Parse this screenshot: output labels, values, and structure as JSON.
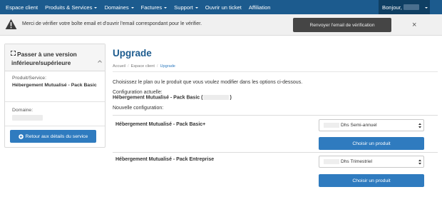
{
  "nav": {
    "items": [
      {
        "label": "Espace client",
        "dropdown": false
      },
      {
        "label": "Produits & Services",
        "dropdown": true
      },
      {
        "label": "Domaines",
        "dropdown": true
      },
      {
        "label": "Factures",
        "dropdown": true
      },
      {
        "label": "Support",
        "dropdown": true
      },
      {
        "label": "Ouvrir un ticket",
        "dropdown": false
      },
      {
        "label": "Affiliation",
        "dropdown": false
      }
    ],
    "greeting": "Bonjour,"
  },
  "alert": {
    "icon": "warning-icon",
    "message": "Merci de vérifier votre boîte email et d'ouvrir l'email correspondant pour le vérifier.",
    "resend_label": "Renvoyer l'email de vérification",
    "close_label": "×"
  },
  "sidebar": {
    "title": "Passer à une version inférieure/supérieure",
    "title_icon": "expand-icon",
    "collapse_icon": "chevron-up-icon",
    "product_label": "Produit/Service:",
    "product_value": "Hébergement Mutualisé - Pack Basic",
    "domain_label": "Domaine:",
    "back_label": "Retour aux détails du service",
    "back_icon": "arrow-circle-left-icon"
  },
  "main": {
    "title": "Upgrade",
    "breadcrumb": [
      "Accueil",
      "Espace client",
      "Upgrade"
    ],
    "intro": "Choisissez le plan ou le produit que vous voulez modifier dans les options ci-dessous.",
    "current_label": "Configuration actuelle:",
    "current_value": "Hébergement Mutualisé - Pack Basic",
    "current_paren_open": "(",
    "current_paren_close": ")",
    "new_label": "Nouvelle configuration:",
    "products": [
      {
        "name": "Hébergement Mutualisé - Pack Basic+",
        "price_option": "Dhs Semi-annuel",
        "button_label": "Choisir un produit"
      },
      {
        "name": "Hébergement Mutualisé - Pack Entreprise",
        "price_option": "Dhs Trimestriel",
        "button_label": "Choisir un produit"
      }
    ]
  },
  "colors": {
    "nav_bg": "#1c5b8e",
    "accent": "#2f7bbf",
    "alert_button": "#454545",
    "title": "#1c5b8e"
  }
}
